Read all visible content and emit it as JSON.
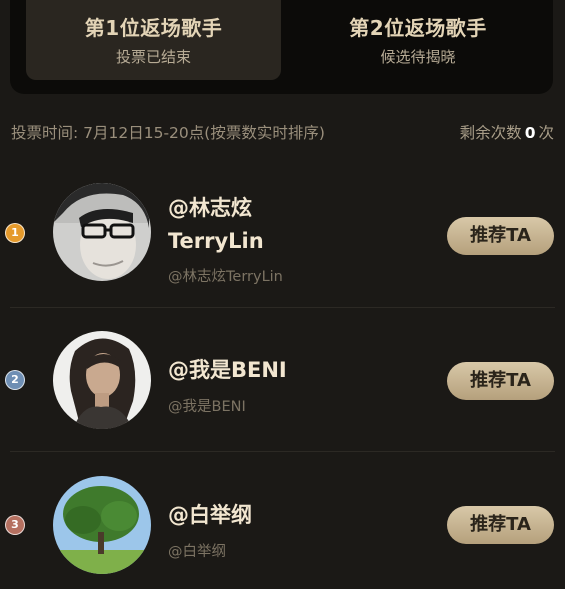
{
  "tabs": [
    {
      "title": "第1位返场歌手",
      "subtitle": "投票已结束",
      "active": true
    },
    {
      "title": "第2位返场歌手",
      "subtitle": "候选待揭晓",
      "active": false
    }
  ],
  "info": {
    "vote_time": "投票时间: 7月12日15-20点(按票数实时排序)",
    "remaining_label": "剩余次数",
    "remaining_count": "0",
    "remaining_unit": "次"
  },
  "candidates": [
    {
      "rank": "1",
      "name_line1": "@林志炫",
      "name_line2": "TerryLin",
      "handle": "@林志炫TerryLin",
      "button": "推荐TA",
      "badge_color": "#e59a2c"
    },
    {
      "rank": "2",
      "name_line1": "@我是BENI",
      "handle": "@我是BENI",
      "button": "推荐TA",
      "badge_color": "#6f8fb4"
    },
    {
      "rank": "3",
      "name_line1": "@白举纲",
      "handle": "@白举纲",
      "button": "推荐TA",
      "badge_color": "#b57060"
    }
  ]
}
